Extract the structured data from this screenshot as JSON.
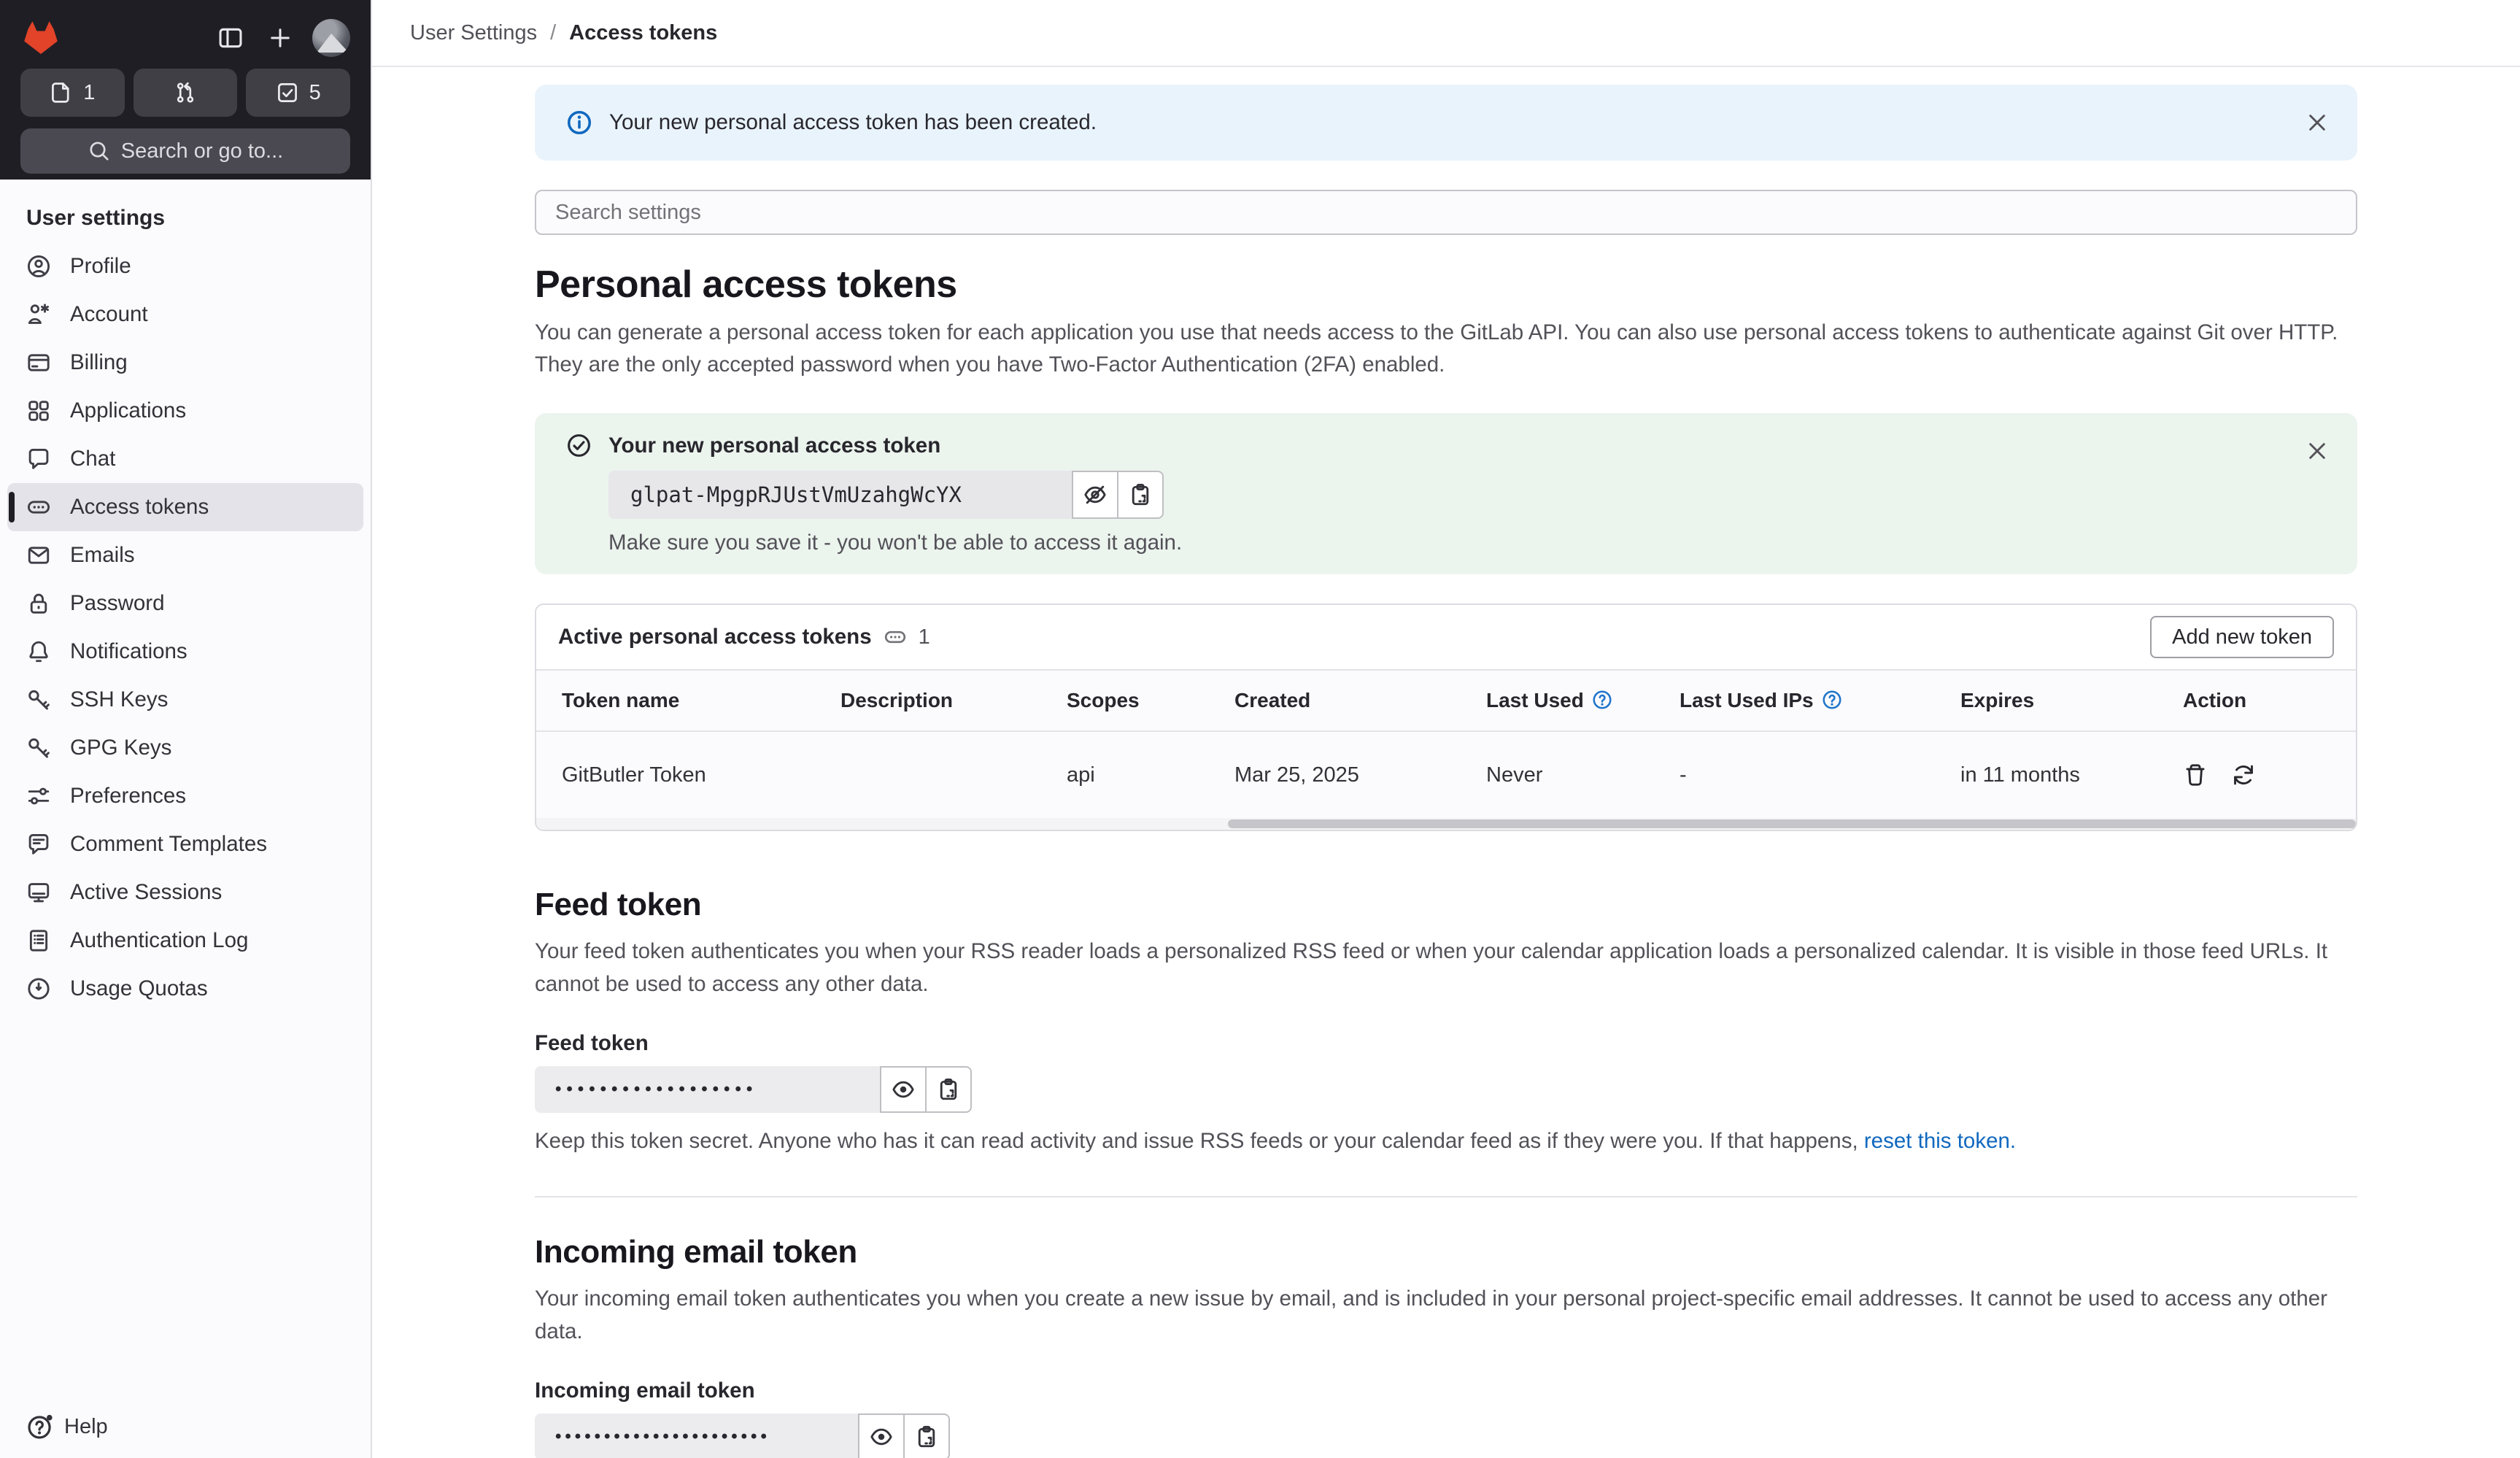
{
  "topbar": {
    "breadcrumb_parent": "User Settings",
    "separator": "/",
    "breadcrumb_current": "Access tokens"
  },
  "sidebar": {
    "issues_count": "1",
    "todos_count": "5",
    "search_placeholder": "Search or go to...",
    "section_title": "User settings",
    "items": [
      {
        "label": "Profile"
      },
      {
        "label": "Account"
      },
      {
        "label": "Billing"
      },
      {
        "label": "Applications"
      },
      {
        "label": "Chat"
      },
      {
        "label": "Access tokens"
      },
      {
        "label": "Emails"
      },
      {
        "label": "Password"
      },
      {
        "label": "Notifications"
      },
      {
        "label": "SSH Keys"
      },
      {
        "label": "GPG Keys"
      },
      {
        "label": "Preferences"
      },
      {
        "label": "Comment Templates"
      },
      {
        "label": "Active Sessions"
      },
      {
        "label": "Authentication Log"
      },
      {
        "label": "Usage Quotas"
      }
    ],
    "help_label": "Help"
  },
  "alerts": {
    "info_text": "Your new personal access token has been created.",
    "success_title": "Your new personal access token",
    "token_value": "glpat-MpgpRJUstVmUzahgWcYX",
    "success_note": "Make sure you save it - you won't be able to access it again."
  },
  "search_settings": {
    "placeholder": "Search settings"
  },
  "pat": {
    "title": "Personal access tokens",
    "description": "You can generate a personal access token for each application you use that needs access to the GitLab API. You can also use personal access tokens to authenticate against Git over HTTP. They are the only accepted password when you have Two-Factor Authentication (2FA) enabled.",
    "card": {
      "title": "Active personal access tokens",
      "count": "1",
      "add_button": "Add new token",
      "columns": [
        "Token name",
        "Description",
        "Scopes",
        "Created",
        "Last Used",
        "Last Used IPs",
        "Expires",
        "Action"
      ],
      "rows": [
        {
          "token_name": "GitButler Token",
          "description": "",
          "scopes": "api",
          "created": "Mar 25, 2025",
          "last_used": "Never",
          "last_used_ips": "-",
          "expires": "in 11 months"
        }
      ]
    }
  },
  "feed": {
    "title": "Feed token",
    "description": "Your feed token authenticates you when your RSS reader loads a personalized RSS feed or when your calendar application loads a personalized calendar. It is visible in those feed URLs. It cannot be used to access any other data.",
    "label": "Feed token",
    "masked_value": "••••••••••••••••••",
    "note_prefix": "Keep this token secret. Anyone who has it can read activity and issue RSS feeds or your calendar feed as if they were you. If that happens, ",
    "note_link": "reset this token."
  },
  "incoming": {
    "title": "Incoming email token",
    "description": "Your incoming email token authenticates you when you create a new issue by email, and is included in your personal project-specific email addresses. It cannot be used to access any other data.",
    "label": "Incoming email token",
    "masked_value": "••••••••••••••••••••••"
  },
  "colors": {
    "brand_orange": "#e24329",
    "sidebar_dark": "#1f1e24",
    "sidebar_bg": "#fbfafd",
    "info_alert_bg": "#e9f3fc",
    "success_alert_bg": "#ecf4ee",
    "link_blue": "#1068bf",
    "help_icon_blue": "#1f75cb",
    "text_primary": "#28272d",
    "text_secondary": "#535158"
  }
}
